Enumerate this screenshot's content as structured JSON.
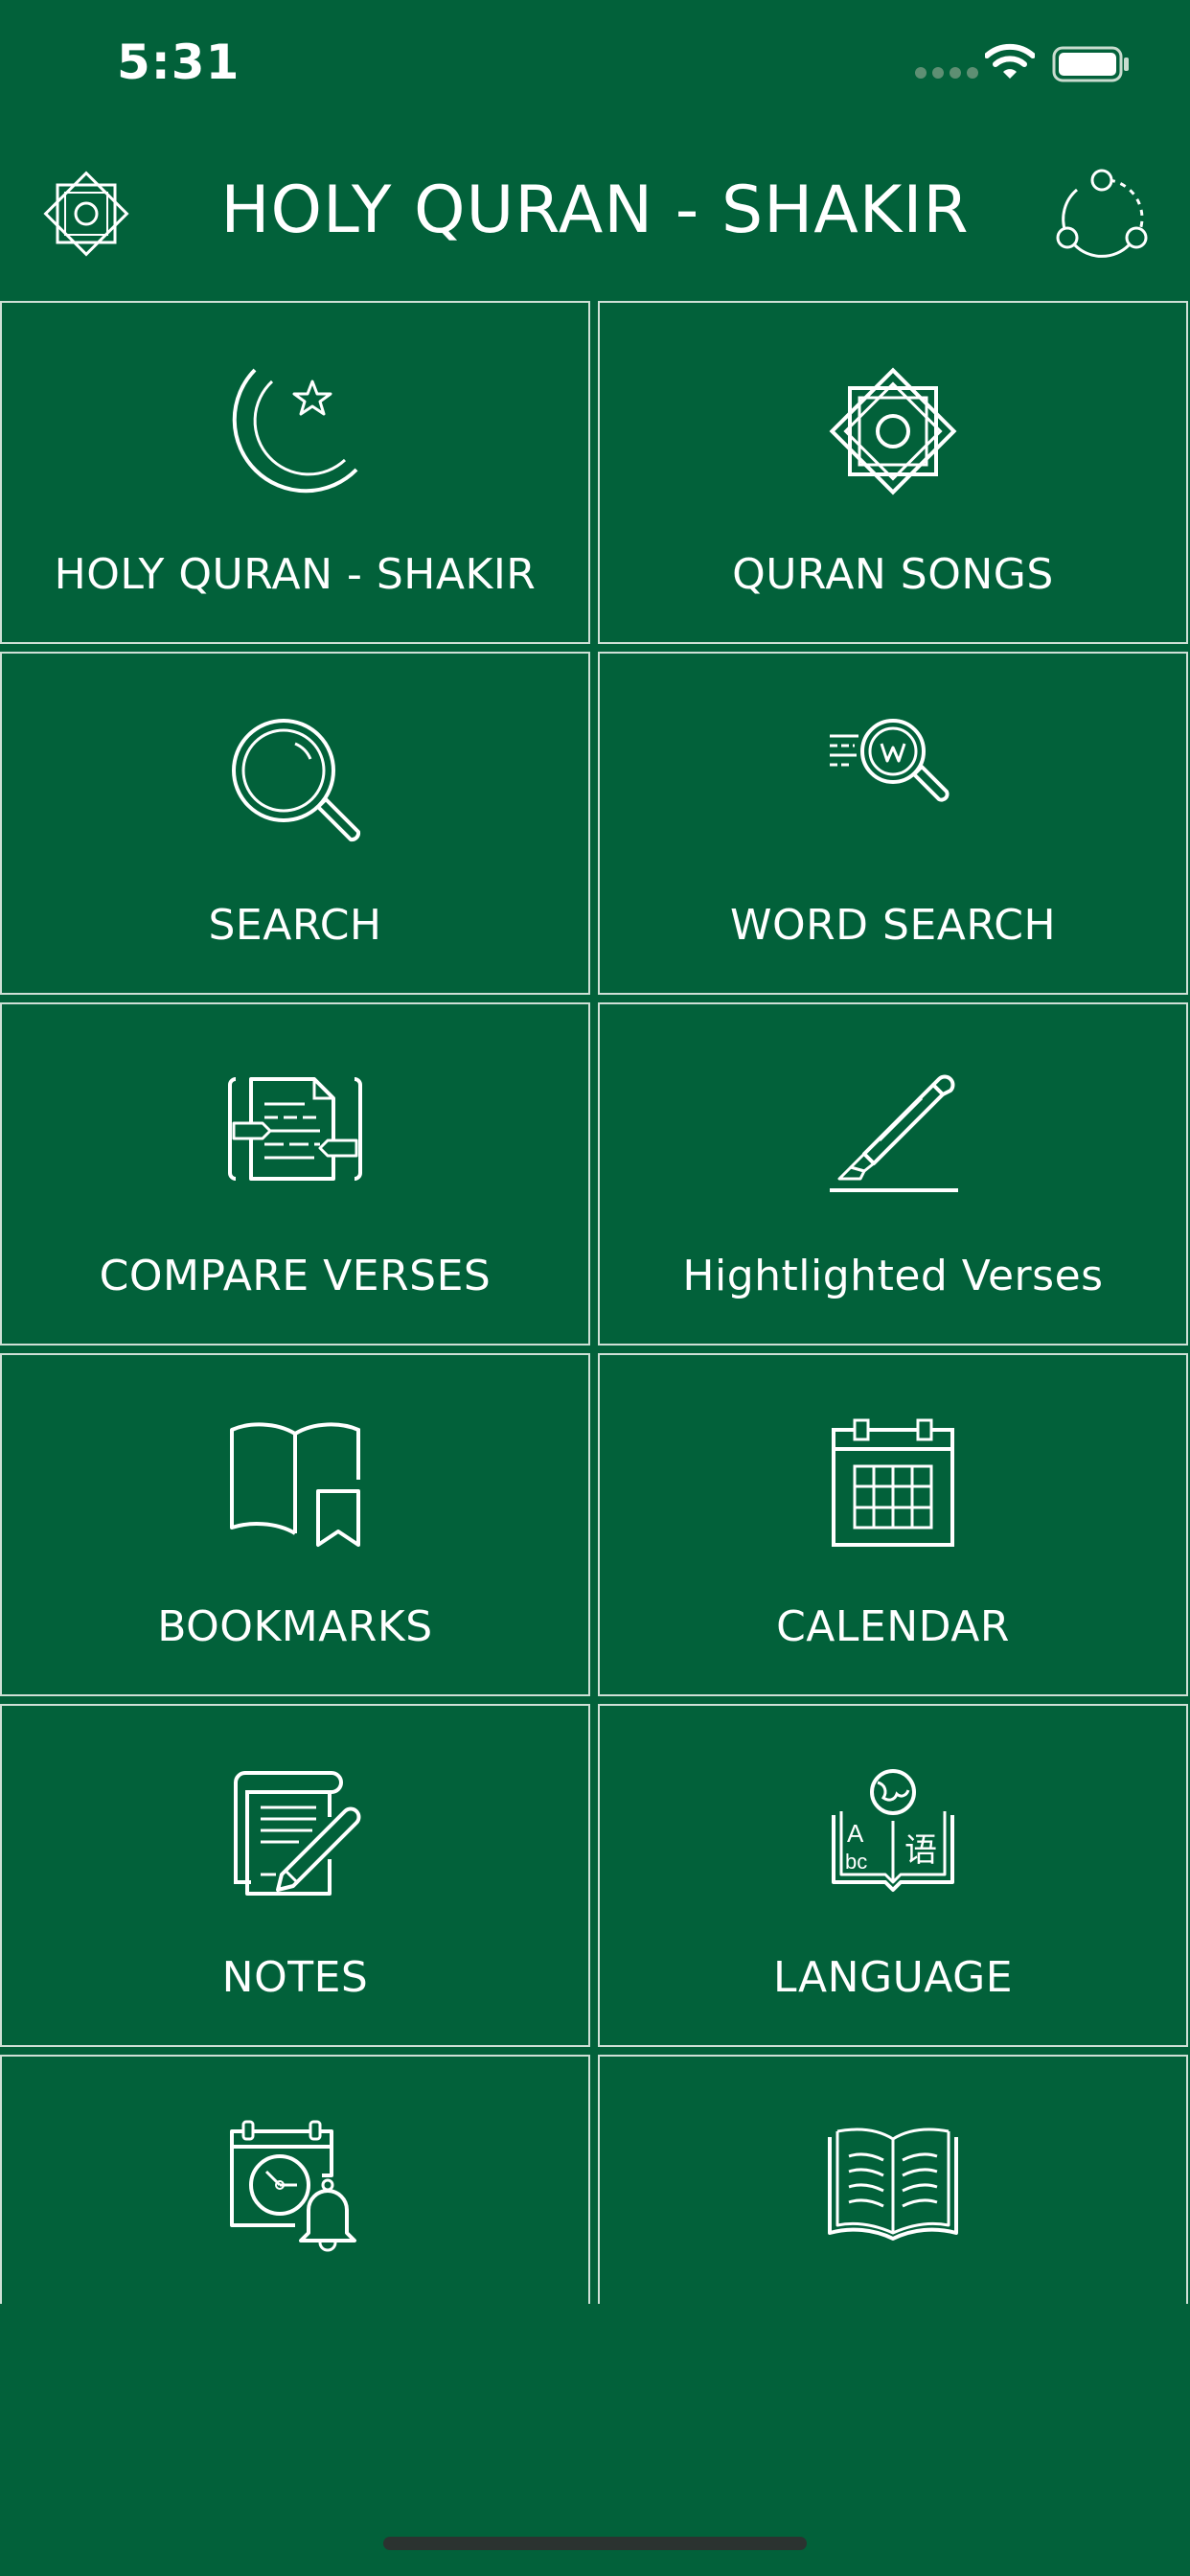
{
  "status_bar": {
    "time": "5:31"
  },
  "header": {
    "title": "HOLY QURAN - SHAKIR",
    "left_icon": "islamic-star-icon",
    "right_icon": "share-icon"
  },
  "tiles": [
    {
      "label": "HOLY QURAN - SHAKIR",
      "icon": "crescent-star-icon"
    },
    {
      "label": "QURAN SONGS",
      "icon": "islamic-star-icon"
    },
    {
      "label": "SEARCH",
      "icon": "magnifier-icon"
    },
    {
      "label": "WORD SEARCH",
      "icon": "word-search-icon"
    },
    {
      "label": "COMPARE VERSES",
      "icon": "compare-document-icon"
    },
    {
      "label": "Hightlighted Verses",
      "icon": "highlighter-pen-icon"
    },
    {
      "label": "BOOKMARKS",
      "icon": "bookmark-book-icon"
    },
    {
      "label": "CALENDAR",
      "icon": "calendar-icon"
    },
    {
      "label": "NOTES",
      "icon": "notes-icon"
    },
    {
      "label": "LANGUAGE",
      "icon": "language-book-icon"
    },
    {
      "label": "",
      "icon": "reminder-calendar-icon"
    },
    {
      "label": "",
      "icon": "open-book-icon"
    }
  ],
  "colors": {
    "background": "#02613a",
    "foreground": "#ffffff",
    "tile_border": "#cfe0d6"
  }
}
